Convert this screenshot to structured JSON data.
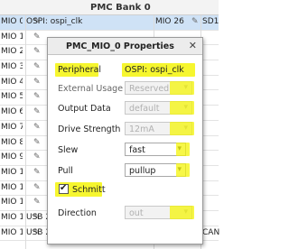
{
  "bank": {
    "title": "PMC Bank 0"
  },
  "rows": [
    {
      "pin": "MIO 0",
      "function": "OSPI: ospi_clk",
      "right_pin": "MIO 26",
      "right_fn": "SD1"
    },
    {
      "pin": "MIO 1",
      "function": "",
      "right_pin": "",
      "right_fn": ""
    },
    {
      "pin": "MIO 2",
      "function": "",
      "right_pin": "",
      "right_fn": ""
    },
    {
      "pin": "MIO 3",
      "function": "",
      "right_pin": "",
      "right_fn": ""
    },
    {
      "pin": "MIO 4",
      "function": "",
      "right_pin": "",
      "right_fn": ""
    },
    {
      "pin": "MIO 5",
      "function": "",
      "right_pin": "",
      "right_fn": ""
    },
    {
      "pin": "MIO 6",
      "function": "",
      "right_pin": "",
      "right_fn": ""
    },
    {
      "pin": "MIO 7",
      "function": "",
      "right_pin": "",
      "right_fn": ""
    },
    {
      "pin": "MIO 8",
      "function": "",
      "right_pin": "",
      "right_fn": ""
    },
    {
      "pin": "MIO 9",
      "function": "",
      "right_pin": "",
      "right_fn": ""
    },
    {
      "pin": "MIO 10",
      "function": "",
      "right_pin": "",
      "right_fn": ""
    },
    {
      "pin": "MIO 11",
      "function": "",
      "right_pin": "",
      "right_fn": ""
    },
    {
      "pin": "MIO 12",
      "function": "",
      "right_pin": "",
      "right_fn": ""
    },
    {
      "pin": "MIO 13",
      "function": "USB 2.0: usb2phy_...",
      "right_pin": "MIO 39",
      "right_fn": ""
    },
    {
      "pin": "MIO 14",
      "function": "USB 2.0: ulpi_tx_dat...",
      "right_pin": "MIO 40",
      "right_fn": "CAN"
    }
  ],
  "dialog": {
    "title": "PMC_MIO_0 Properties",
    "close_icon": "close-icon",
    "peripheral_label": "Peripheral",
    "peripheral_value": "OSPI: ospi_clk",
    "external_usage_label": "External Usage",
    "external_usage_value": "Reserved",
    "output_data_label": "Output Data",
    "output_data_value": "default",
    "drive_strength_label": "Drive Strength",
    "drive_strength_value": "12mA",
    "slew_label": "Slew",
    "slew_value": "fast",
    "pull_label": "Pull",
    "pull_value": "pullup",
    "schmitt_label": "Schmitt",
    "schmitt_checked": true,
    "direction_label": "Direction",
    "direction_value": "out"
  },
  "colors": {
    "highlight": "#f4f40a",
    "selected_row": "#cfe2f6"
  }
}
